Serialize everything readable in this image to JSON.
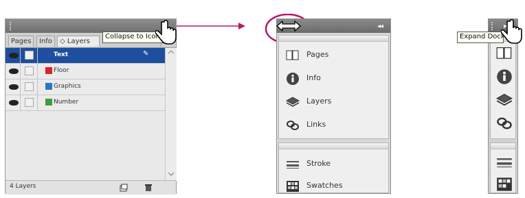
{
  "panel_layers": {
    "tabs": [
      {
        "label": "Pages"
      },
      {
        "label": "Info"
      },
      {
        "label": "◇ Layers"
      }
    ],
    "tooltip": "Collapse to Icons",
    "layers": [
      {
        "name": "Text",
        "color": "#1f4fa8",
        "selected": true
      },
      {
        "name": "Floor",
        "color": "#d8242a",
        "selected": false
      },
      {
        "name": "Graphics",
        "color": "#2a78c2",
        "selected": false
      },
      {
        "name": "Number",
        "color": "#3f9d3f",
        "selected": false
      }
    ],
    "status": "4 Layers",
    "collapse_label": "◂◂"
  },
  "panel_collapsed": {
    "collapse_label": "◂◂",
    "group1": [
      {
        "label": "Pages",
        "icon": "pages-icon"
      },
      {
        "label": "Info",
        "icon": "info-icon"
      },
      {
        "label": "Layers",
        "icon": "layers-icon"
      },
      {
        "label": "Links",
        "icon": "links-icon"
      }
    ],
    "group2": [
      {
        "label": "Stroke",
        "icon": "stroke-icon"
      },
      {
        "label": "Swatches",
        "icon": "swatches-icon"
      }
    ]
  },
  "panel_icons": {
    "tooltip": "Expand Docks",
    "expand_label": "▸▸"
  },
  "colors": {
    "accent": "#b5176c",
    "selection": "#1d4f9e"
  }
}
